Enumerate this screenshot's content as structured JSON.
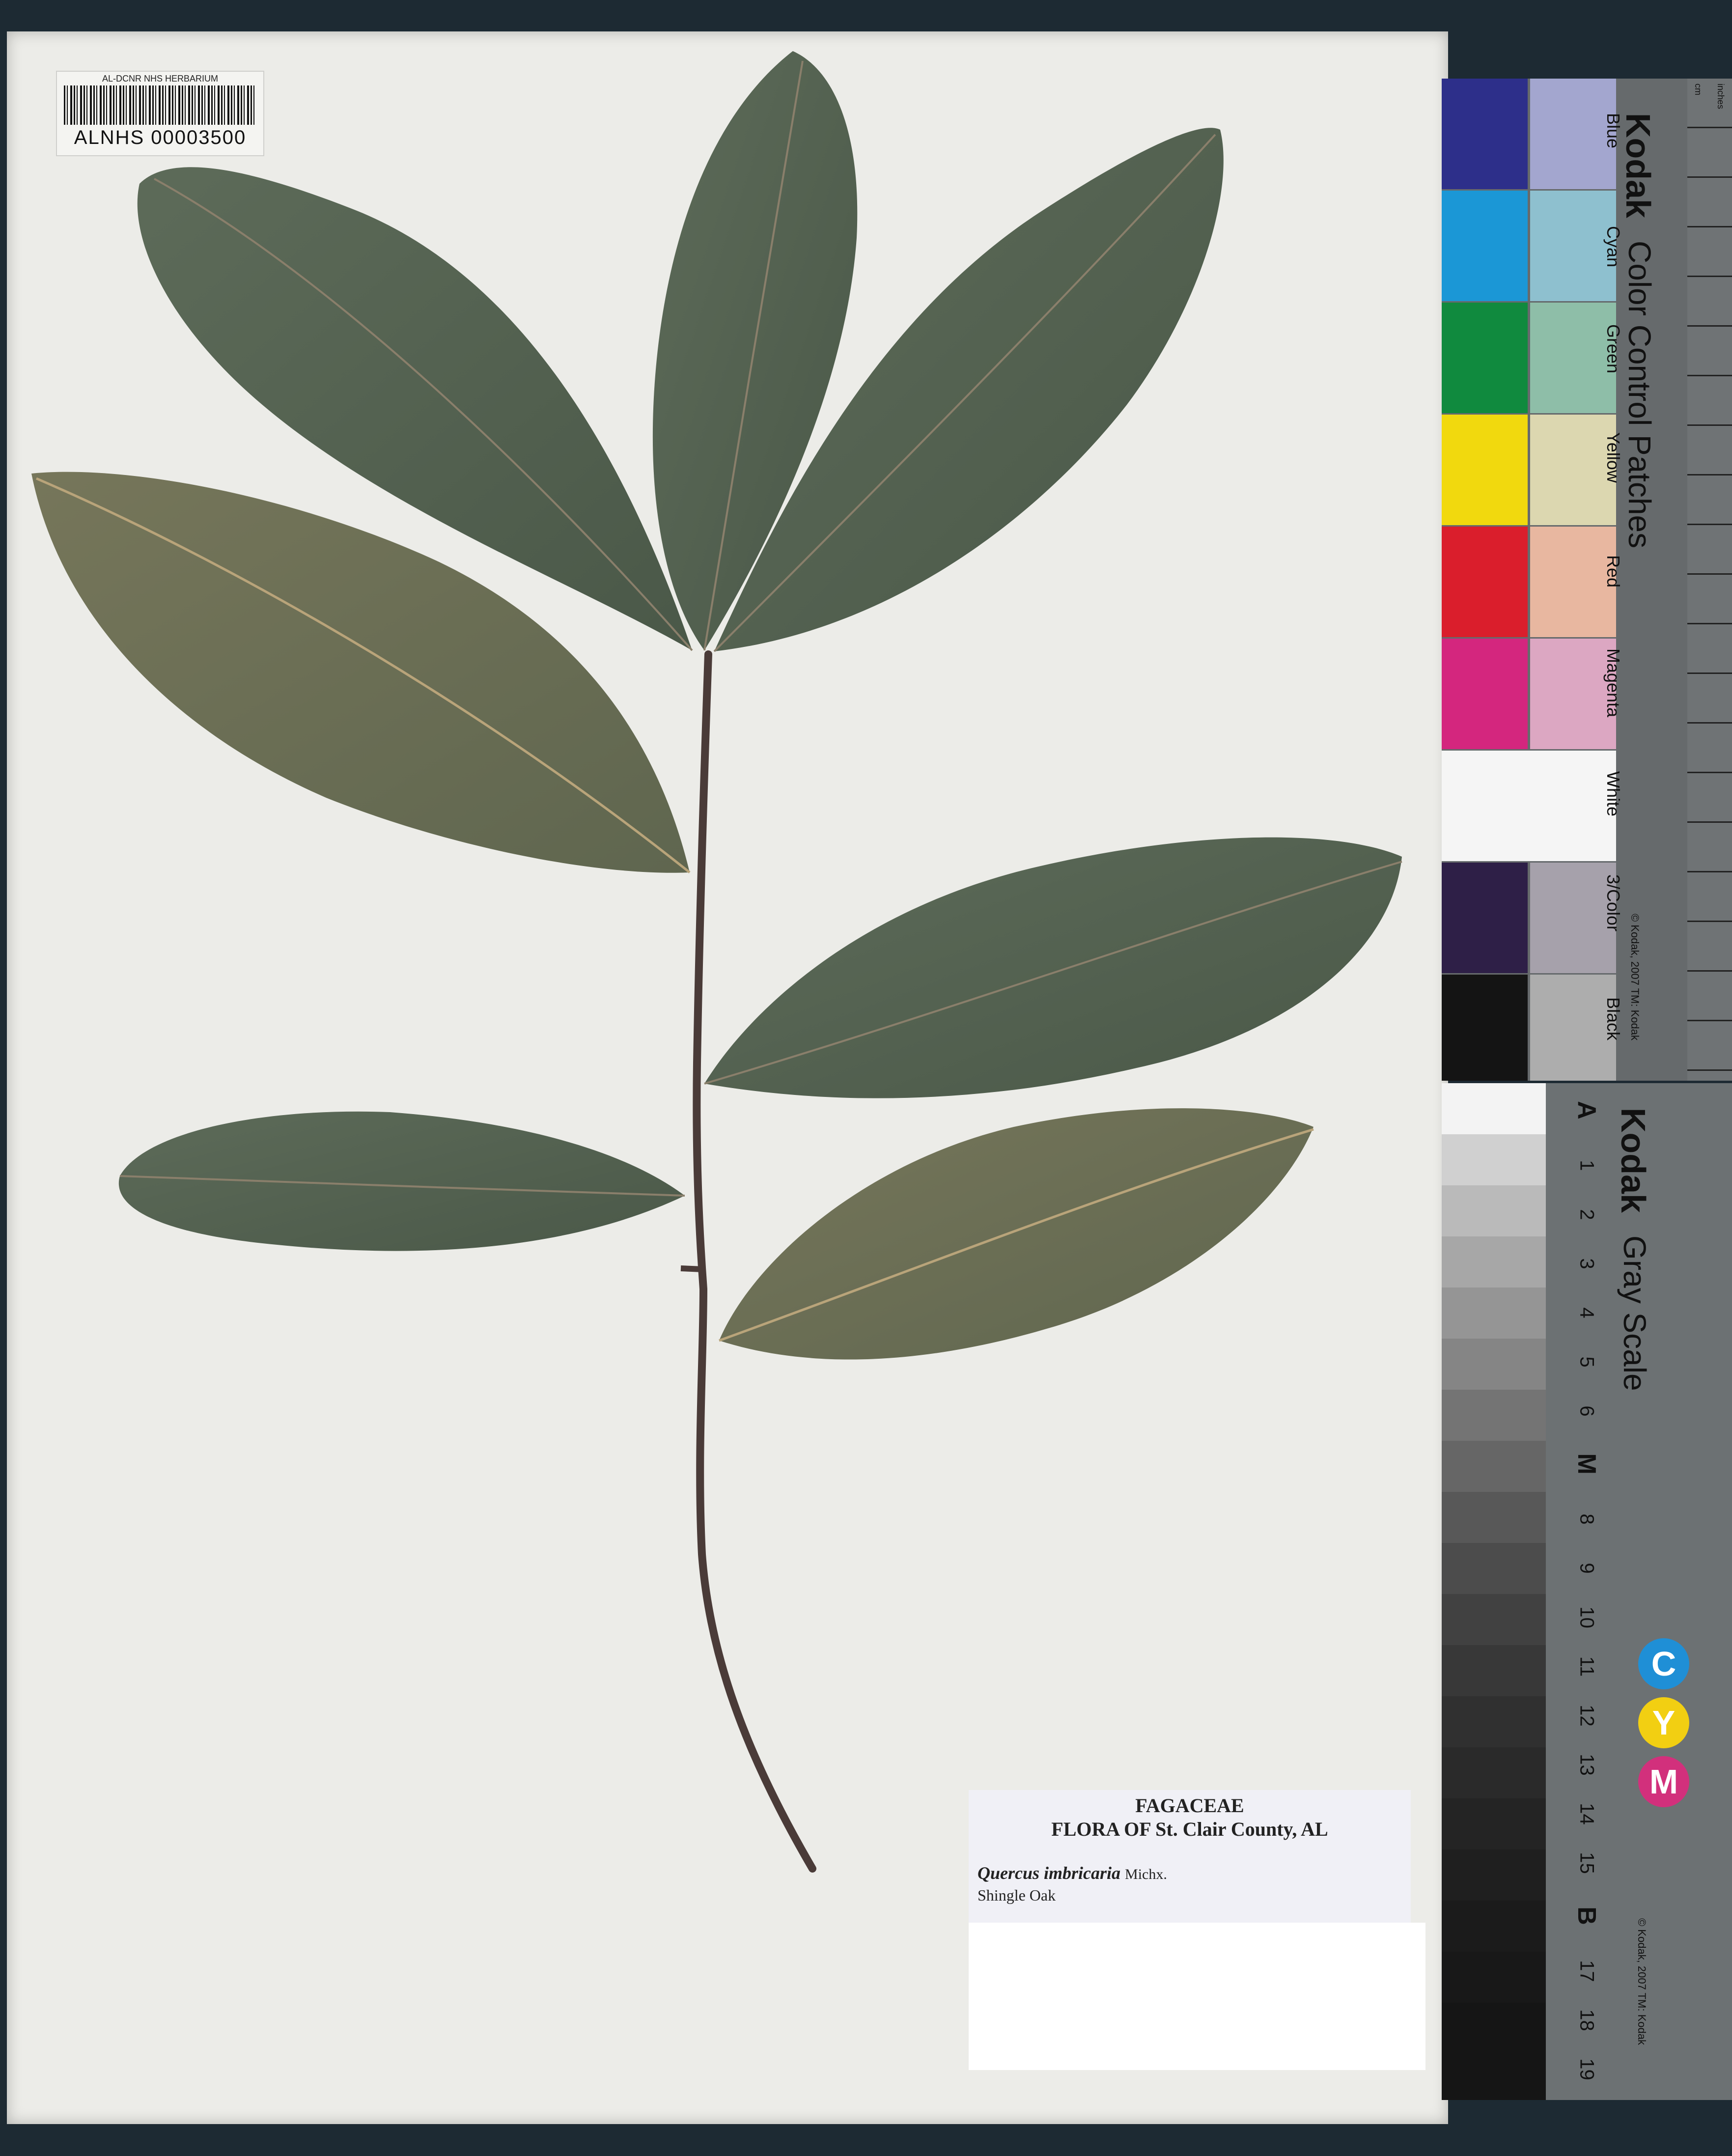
{
  "barcode": {
    "header": "AL-DCNR NHS HERBARIUM",
    "number": "ALNHS 00003500"
  },
  "label": {
    "family": "FAGACEAE",
    "flora": "FLORA OF St. Clair County, AL",
    "scientific_name": "Quercus imbricaria",
    "author": "Michx.",
    "common_name": "Shingle Oak"
  },
  "color_card": {
    "brand": "Kodak",
    "title": "Color Control Patches",
    "patch_names": [
      "Blue",
      "Cyan",
      "Green",
      "Yellow",
      "Red",
      "Magenta",
      "White",
      "3/Color",
      "Black"
    ],
    "copyright": "© Kodak, 2007 TM: Kodak",
    "colors": {
      "blue": "#2d2f8a",
      "blue_light": "#a3a6cf",
      "cyan": "#1b97d6",
      "cyan_light": "#8ec0cf",
      "green": "#108a3e",
      "green_light": "#8ebea8",
      "yellow": "#f1d90e",
      "yellow_light": "#dcd7b0",
      "red": "#da1e2c",
      "red_light": "#e8b7a0",
      "magenta": "#d4267e",
      "magenta_light": "#dca7c2",
      "white": "#f5f5f5",
      "three_color": "#2e1f47",
      "three_color_light": "#a6a1ab",
      "black": "#141414",
      "black_light": "#adadad"
    }
  },
  "ruler": {
    "unit_top": "inches",
    "unit_cm": "cm"
  },
  "gray_scale": {
    "brand": "Kodak",
    "title": "Gray Scale",
    "labels": [
      "A",
      "1",
      "2",
      "3",
      "4",
      "5",
      "6",
      "M",
      "8",
      "9",
      "10",
      "11",
      "12",
      "13",
      "14",
      "15",
      "B",
      "17",
      "18",
      "19"
    ],
    "copyright": "© Kodak, 2007 TM: Kodak",
    "cym": [
      "C",
      "Y",
      "M"
    ],
    "cym_colors": [
      "#1f8fd6",
      "#f2cf12",
      "#d2307c"
    ]
  }
}
